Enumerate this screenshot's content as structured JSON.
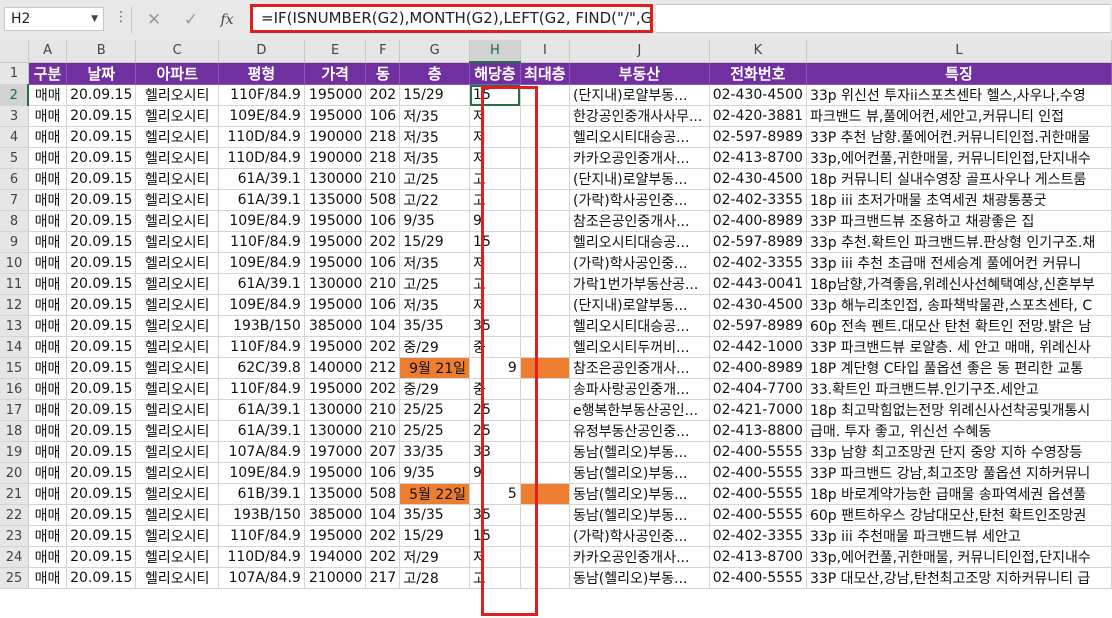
{
  "formula_bar": {
    "name_box": "H2",
    "dots": "⋮",
    "cancel_icon": "✕",
    "enter_icon": "✓",
    "fx_label": "fx",
    "formula": "=IF(ISNUMBER(G2),MONTH(G2),LEFT(G2, FIND(\"/\",G2)-1))"
  },
  "columns": [
    "A",
    "B",
    "C",
    "D",
    "E",
    "F",
    "G",
    "H",
    "I",
    "J",
    "K",
    "L"
  ],
  "selected_column": "H",
  "header_row": {
    "row_number": "1",
    "cells": [
      "구분",
      "날짜",
      "아파트",
      "평형",
      "가격",
      "동",
      "층",
      "해당층",
      "최대층",
      "부동산",
      "전화번호",
      "특징"
    ]
  },
  "rows": [
    {
      "n": "2",
      "a": "매매",
      "b": "20.09.15",
      "c": "헬리오시티",
      "d": "110F/84.9",
      "e": "195000",
      "f": "202",
      "g": "15/29",
      "h": "15",
      "i": "",
      "j": "(단지내)로얄부동...",
      "k": "02-430-4500",
      "l": "33p 위신선 투자ii스포츠센타 헬스,사우나,수영"
    },
    {
      "n": "3",
      "a": "매매",
      "b": "20.09.15",
      "c": "헬리오시티",
      "d": "109E/84.9",
      "e": "195000",
      "f": "106",
      "g": "저/35",
      "h": "저",
      "i": "",
      "j": "한강공인중개사사무...",
      "k": "02-420-3881",
      "l": "파크밴드 뷰,풀에어컨,세안고,커뮤니티 인접"
    },
    {
      "n": "4",
      "a": "매매",
      "b": "20.09.15",
      "c": "헬리오시티",
      "d": "110D/84.9",
      "e": "190000",
      "f": "218",
      "g": "저/35",
      "h": "저",
      "i": "",
      "j": "헬리오시티대승공...",
      "k": "02-597-8989",
      "l": "33P 추천 남향.풀에어컨.커뮤니티인접.귀한매물"
    },
    {
      "n": "5",
      "a": "매매",
      "b": "20.09.15",
      "c": "헬리오시티",
      "d": "110D/84.9",
      "e": "190000",
      "f": "218",
      "g": "저/35",
      "h": "저",
      "i": "",
      "j": "카카오공인중개사...",
      "k": "02-413-8700",
      "l": "33p,에어컨풀,귀한매물, 커뮤니티인접,단지내수"
    },
    {
      "n": "6",
      "a": "매매",
      "b": "20.09.15",
      "c": "헬리오시티",
      "d": "61A/39.1",
      "e": "130000",
      "f": "210",
      "g": "고/25",
      "h": "고",
      "i": "",
      "j": "(단지내)로얄부동...",
      "k": "02-430-4500",
      "l": "18p 커뮤니티 실내수영장 골프사우나 게스트룸"
    },
    {
      "n": "7",
      "a": "매매",
      "b": "20.09.15",
      "c": "헬리오시티",
      "d": "61A/39.1",
      "e": "135000",
      "f": "508",
      "g": "고/22",
      "h": "고",
      "i": "",
      "j": "(가락)학사공인중...",
      "k": "02-402-3355",
      "l": "18p iii 초저가매물 초역세권 채광통풍굿"
    },
    {
      "n": "8",
      "a": "매매",
      "b": "20.09.15",
      "c": "헬리오시티",
      "d": "109E/84.9",
      "e": "195000",
      "f": "106",
      "g": "9/35",
      "h": "9",
      "i": "",
      "j": "참조은공인중개사...",
      "k": "02-400-8989",
      "l": "33P 파크밴드뷰 조용하고 채광좋은 집"
    },
    {
      "n": "9",
      "a": "매매",
      "b": "20.09.15",
      "c": "헬리오시티",
      "d": "110F/84.9",
      "e": "195000",
      "f": "202",
      "g": "15/29",
      "h": "15",
      "i": "",
      "j": "헬리오시티대승공...",
      "k": "02-597-8989",
      "l": "33p 추천.확트인 파크밴드뷰.판상형 인기구조.채"
    },
    {
      "n": "10",
      "a": "매매",
      "b": "20.09.15",
      "c": "헬리오시티",
      "d": "109E/84.9",
      "e": "195000",
      "f": "106",
      "g": "저/35",
      "h": "저",
      "i": "",
      "j": "(가락)학사공인중...",
      "k": "02-402-3355",
      "l": "33p iii 추천 초급매 전세승계 풀에어컨 커뮤니"
    },
    {
      "n": "11",
      "a": "매매",
      "b": "20.09.15",
      "c": "헬리오시티",
      "d": "61A/39.1",
      "e": "130000",
      "f": "210",
      "g": "고/25",
      "h": "고",
      "i": "",
      "j": "가락1번가부동산공...",
      "k": "02-443-0041",
      "l": "18p남향,가격좋음,위례신사선혜택예상,신혼부부"
    },
    {
      "n": "12",
      "a": "매매",
      "b": "20.09.15",
      "c": "헬리오시티",
      "d": "109E/84.9",
      "e": "195000",
      "f": "106",
      "g": "저/35",
      "h": "저",
      "i": "",
      "j": "(단지내)로얄부동...",
      "k": "02-430-4500",
      "l": "33p 해누리초인접, 송파책박물관,스포츠센타, C"
    },
    {
      "n": "13",
      "a": "매매",
      "b": "20.09.15",
      "c": "헬리오시티",
      "d": "193B/150",
      "e": "385000",
      "f": "104",
      "g": "35/35",
      "h": "35",
      "i": "",
      "j": "헬리오시티대승공...",
      "k": "02-597-8989",
      "l": "60p 전속 펜트.대모산 탄천 확트인 전망.밝은 남"
    },
    {
      "n": "14",
      "a": "매매",
      "b": "20.09.15",
      "c": "헬리오시티",
      "d": "110F/84.9",
      "e": "195000",
      "f": "202",
      "g": "중/29",
      "h": "중",
      "i": "",
      "j": "헬리오시티두꺼비...",
      "k": "02-442-1000",
      "l": "33P 파크밴드뷰 로얄층. 세 안고 매매, 위례신사"
    },
    {
      "n": "15",
      "a": "매매",
      "b": "20.09.15",
      "c": "헬리오시티",
      "d": "62C/39.8",
      "e": "140000",
      "f": "212",
      "g": "9월 21일",
      "h": "9",
      "i": "",
      "j": "참조은공인중개사...",
      "k": "02-400-8989",
      "l": "18P 계단형 C타입 풀옵션 좋은 동 편리한 교통",
      "orange": true
    },
    {
      "n": "16",
      "a": "매매",
      "b": "20.09.15",
      "c": "헬리오시티",
      "d": "110F/84.9",
      "e": "195000",
      "f": "202",
      "g": "중/29",
      "h": "중",
      "i": "",
      "j": "송파사랑공인중개...",
      "k": "02-404-7700",
      "l": "33.확트인 파크밴드뷰.인기구조.세안고"
    },
    {
      "n": "17",
      "a": "매매",
      "b": "20.09.15",
      "c": "헬리오시티",
      "d": "61A/39.1",
      "e": "130000",
      "f": "210",
      "g": "25/25",
      "h": "25",
      "i": "",
      "j": "e행복한부동산공인...",
      "k": "02-421-7000",
      "l": "18p 최고막힘없는전망 위례신사선착공및개통시"
    },
    {
      "n": "18",
      "a": "매매",
      "b": "20.09.15",
      "c": "헬리오시티",
      "d": "61A/39.1",
      "e": "130000",
      "f": "210",
      "g": "25/25",
      "h": "25",
      "i": "",
      "j": "유정부동산공인중...",
      "k": "02-413-8800",
      "l": "급매. 투자 좋고, 위신선 수혜동"
    },
    {
      "n": "19",
      "a": "매매",
      "b": "20.09.15",
      "c": "헬리오시티",
      "d": "107A/84.9",
      "e": "197000",
      "f": "207",
      "g": "33/35",
      "h": "33",
      "i": "",
      "j": "동남(헬리오)부동...",
      "k": "02-400-5555",
      "l": "33p 남향 최고조망권 단지 중앙 지하 수영장등"
    },
    {
      "n": "20",
      "a": "매매",
      "b": "20.09.15",
      "c": "헬리오시티",
      "d": "109E/84.9",
      "e": "195000",
      "f": "106",
      "g": "9/35",
      "h": "9",
      "i": "",
      "j": "동남(헬리오)부동...",
      "k": "02-400-5555",
      "l": "33P 파크밴드 강남,최고조망 풀옵션 지하커뮤니"
    },
    {
      "n": "21",
      "a": "매매",
      "b": "20.09.15",
      "c": "헬리오시티",
      "d": "61B/39.1",
      "e": "135000",
      "f": "508",
      "g": "5월 22일",
      "h": "5",
      "i": "",
      "j": "동남(헬리오)부동...",
      "k": "02-400-5555",
      "l": "18p 바로계약가능한 급매물 송파역세권 옵션풀",
      "orange": true
    },
    {
      "n": "22",
      "a": "매매",
      "b": "20.09.15",
      "c": "헬리오시티",
      "d": "193B/150",
      "e": "385000",
      "f": "104",
      "g": "35/35",
      "h": "35",
      "i": "",
      "j": "동남(헬리오)부동...",
      "k": "02-400-5555",
      "l": "60p 팬트하우스 강남대모산,탄천 확트인조망권"
    },
    {
      "n": "23",
      "a": "매매",
      "b": "20.09.15",
      "c": "헬리오시티",
      "d": "110F/84.9",
      "e": "195000",
      "f": "202",
      "g": "15/29",
      "h": "15",
      "i": "",
      "j": "(가락)학사공인중...",
      "k": "02-402-3355",
      "l": "33p iii 추천매물 파크밴드뷰 세안고"
    },
    {
      "n": "24",
      "a": "매매",
      "b": "20.09.15",
      "c": "헬리오시티",
      "d": "110D/84.9",
      "e": "194000",
      "f": "202",
      "g": "저/29",
      "h": "저",
      "i": "",
      "j": "카카오공인중개사...",
      "k": "02-413-8700",
      "l": "33p,에어컨풀,귀한매물, 커뮤니티인접,단지내수"
    },
    {
      "n": "25",
      "a": "매매",
      "b": "20.09.15",
      "c": "헬리오시티",
      "d": "107A/84.9",
      "e": "210000",
      "f": "217",
      "g": "고/28",
      "h": "고",
      "i": "",
      "j": "동남(헬리오)부동...",
      "k": "02-400-5555",
      "l": "33P 대모산,강남,탄천최고조망 지하커뮤니티 급"
    }
  ],
  "colors": {
    "header_bg": "#7030a0",
    "highlight": "#ed7d31",
    "annotation": "#e01e1e",
    "selection": "#217346"
  }
}
